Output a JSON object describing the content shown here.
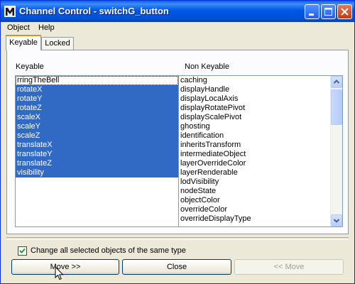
{
  "window": {
    "title": "Channel Control - switchG_button"
  },
  "menubar": {
    "items": [
      {
        "label": "Object"
      },
      {
        "label": "Help"
      }
    ]
  },
  "tabs": [
    {
      "label": "Keyable",
      "active": true
    },
    {
      "label": "Locked",
      "active": false
    }
  ],
  "keyable": {
    "header": "Keyable",
    "items": [
      {
        "label": "rringTheBell",
        "selected": false,
        "focused": true
      },
      {
        "label": "rotateX",
        "selected": true
      },
      {
        "label": "rotateY",
        "selected": true
      },
      {
        "label": "rotateZ",
        "selected": true
      },
      {
        "label": "scaleX",
        "selected": true
      },
      {
        "label": "scaleY",
        "selected": true
      },
      {
        "label": "scaleZ",
        "selected": true
      },
      {
        "label": "translateX",
        "selected": true
      },
      {
        "label": "translateY",
        "selected": true
      },
      {
        "label": "translateZ",
        "selected": true
      },
      {
        "label": "visibility",
        "selected": true
      }
    ]
  },
  "nonkeyable": {
    "header": "Non Keyable",
    "items": [
      "caching",
      "displayHandle",
      "displayLocalAxis",
      "displayRotatePivot",
      "displayScalePivot",
      "ghosting",
      "identification",
      "inheritsTransform",
      "intermediateObject",
      "layerOverrideColor",
      "layerRenderable",
      "lodVisibility",
      "nodeState",
      "objectColor",
      "overrideColor",
      "overrideDisplayType"
    ]
  },
  "options": {
    "change_all_label": "Change all selected objects of the same type",
    "change_all_checked": true
  },
  "buttons": {
    "move": "Move >>",
    "close": "Close",
    "move_back": "<< Move"
  },
  "colors": {
    "selection": "#316ac5",
    "titlebar": "#0058e6"
  },
  "icons": {
    "app": "maya-icon",
    "minimize": "minimize-icon",
    "maximize": "maximize-icon",
    "close": "close-icon"
  }
}
